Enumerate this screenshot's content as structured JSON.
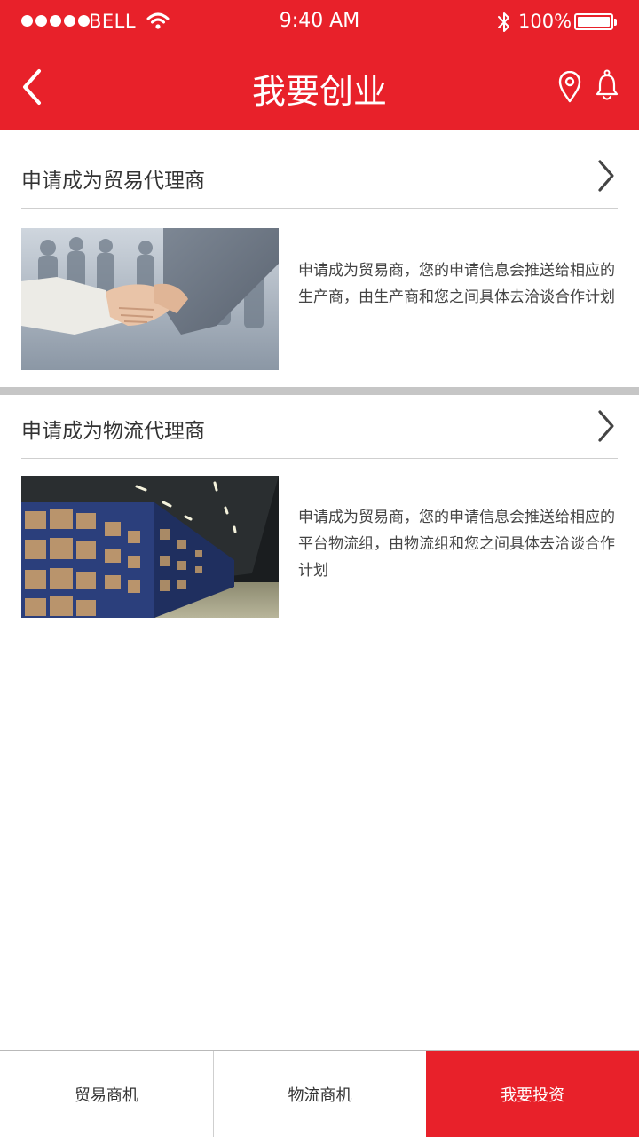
{
  "status_bar": {
    "carrier": "BELL",
    "time": "9:40 AM",
    "battery": "100%"
  },
  "header": {
    "title": "我要创业",
    "icons": [
      "back-arrow-icon",
      "location-pin-icon",
      "bell-icon"
    ]
  },
  "sections": [
    {
      "title": "申请成为贸易代理商",
      "image": "handshake-photo",
      "description": "申请成为贸易商，您的申请信息会推送给相应的生产商，由生产商和您之间具体去洽谈合作计划"
    },
    {
      "title": "申请成为物流代理商",
      "image": "warehouse-photo",
      "description": "申请成为贸易商，您的申请信息会推送给相应的平台物流组，由物流组和您之间具体去洽谈合作计划"
    }
  ],
  "tabbar": {
    "tabs": [
      "贸易商机",
      "物流商机",
      "我要投资"
    ],
    "active_tab": "我要投资"
  },
  "colors": {
    "brand_red": "#e8212a",
    "divider_gray": "#c6c6c6"
  }
}
